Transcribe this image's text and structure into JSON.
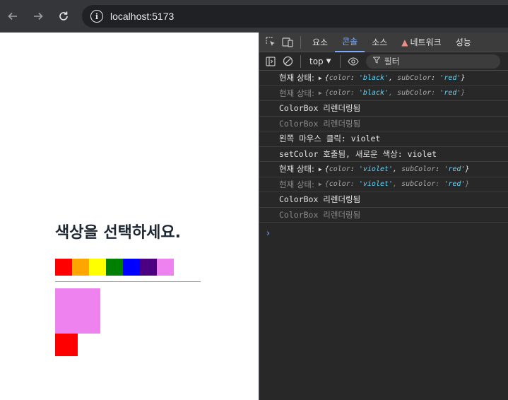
{
  "browser": {
    "url": "localhost:5173",
    "back_icon": "arrow-left-icon",
    "forward_icon": "arrow-right-icon",
    "reload_icon": "reload-icon"
  },
  "page": {
    "title": "색상을 선택하세요.",
    "palette": [
      "#ff0000",
      "#ffa500",
      "#ffff00",
      "#008000",
      "#0000ff",
      "#4b0082",
      "#ee82ee"
    ],
    "big_box_color": "#ee82ee",
    "small_box_color": "#ff0000"
  },
  "devtools": {
    "tabs": [
      "요소",
      "콘솔",
      "소스",
      "네트워크",
      "성능"
    ],
    "active_tab": "콘솔",
    "context": "top",
    "filter_placeholder": "필터",
    "logs": [
      {
        "type": "state",
        "dim": false,
        "label": "현재 상태:",
        "color": "'black'",
        "subColor": "'red'"
      },
      {
        "type": "state",
        "dim": true,
        "label": "현재 상태:",
        "color": "'black'",
        "subColor": "'red'"
      },
      {
        "type": "text",
        "dim": false,
        "text": "ColorBox 리렌더링됨"
      },
      {
        "type": "text",
        "dim": true,
        "text": "ColorBox 리렌더링됨"
      },
      {
        "type": "text",
        "dim": false,
        "text": "왼쪽 마우스 클릭: violet"
      },
      {
        "type": "text",
        "dim": false,
        "text": "setColor 호출됨, 새로운 색상: violet"
      },
      {
        "type": "state",
        "dim": false,
        "label": "현재 상태:",
        "color": "'violet'",
        "subColor": "'red'"
      },
      {
        "type": "state",
        "dim": true,
        "label": "현재 상태:",
        "color": "'violet'",
        "subColor": "'red'"
      },
      {
        "type": "text",
        "dim": false,
        "text": "ColorBox 리렌더링됨"
      },
      {
        "type": "text",
        "dim": true,
        "text": "ColorBox 리렌더링됨"
      }
    ],
    "obj_keys": {
      "color": "color",
      "subColor": "subColor"
    },
    "prompt_symbol": "›"
  }
}
